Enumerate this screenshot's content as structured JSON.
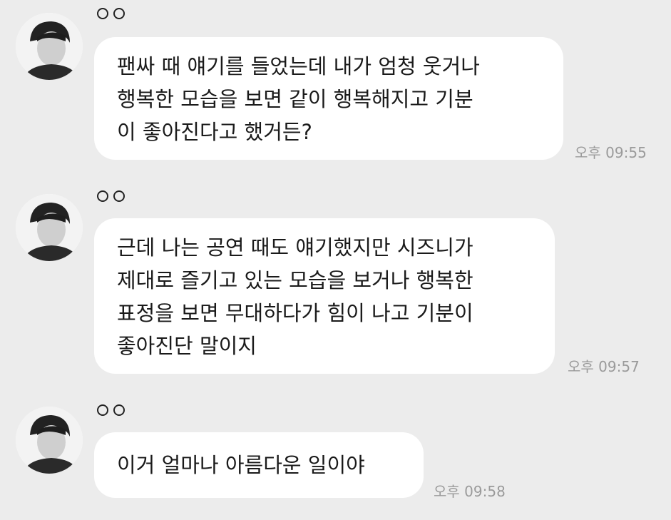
{
  "messages": [
    {
      "sender": "",
      "lines": [
        "팬싸 때 얘기를 들었는데 내가 엄청 웃거나",
        "행복한 모습을 보면 같이 행복해지고 기분",
        "이 좋아진다고 했거든?"
      ],
      "time": "오후 09:55"
    },
    {
      "sender": "",
      "lines": [
        "근데 나는 공연 때도 얘기했지만 시즈니가",
        "제대로 즐기고 있는 모습을 보거나 행복한",
        "표정을 보면 무대하다가 힘이 나고 기분이",
        "좋아진단 말이지"
      ],
      "time": "오후 09:57"
    },
    {
      "sender": "",
      "lines": [
        "이거 얼마나 아름다운 일이야"
      ],
      "time": "오후 09:58"
    }
  ],
  "colors": {
    "background": "#ececec",
    "bubble": "#ffffff",
    "time": "#9a9a9a"
  },
  "icons": {
    "avatar": "profile-photo",
    "sender_mark": "double-circle-icon"
  }
}
